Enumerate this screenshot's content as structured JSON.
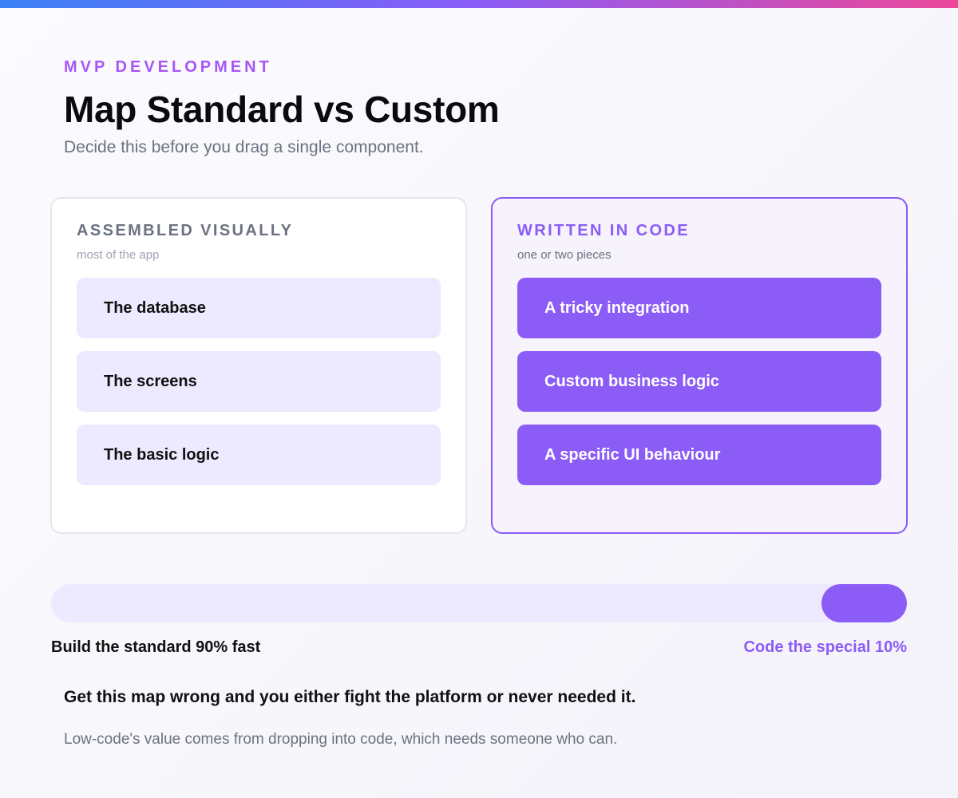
{
  "header": {
    "eyebrow": "MVP DEVELOPMENT",
    "title": "Map Standard vs Custom",
    "subtitle": "Decide this before you drag a single component."
  },
  "cards": {
    "visual": {
      "heading": "ASSEMBLED VISUALLY",
      "subheading": "most of the app",
      "items": [
        "The database",
        "The screens",
        "The basic logic"
      ]
    },
    "code": {
      "heading": "WRITTEN IN CODE",
      "subheading": "one or two pieces",
      "items": [
        "A tricky integration",
        "Custom business logic",
        "A specific UI behaviour"
      ]
    }
  },
  "split": {
    "standard_fraction": 0.9,
    "custom_fraction": 0.1,
    "standard_label": "Build the standard 90% fast",
    "custom_label": "Code the special 10%"
  },
  "footer": {
    "callout": "Get this map wrong and you either fight the platform or never needed it.",
    "note": "Low-code's value comes from dropping into code, which needs someone who can."
  },
  "colors": {
    "accent": "#8b5cf6",
    "accent_light": "#ede9fe",
    "eyebrow": "#a855f7",
    "gradient": [
      "#3b82f6",
      "#8b5cf6",
      "#ec4899"
    ]
  }
}
